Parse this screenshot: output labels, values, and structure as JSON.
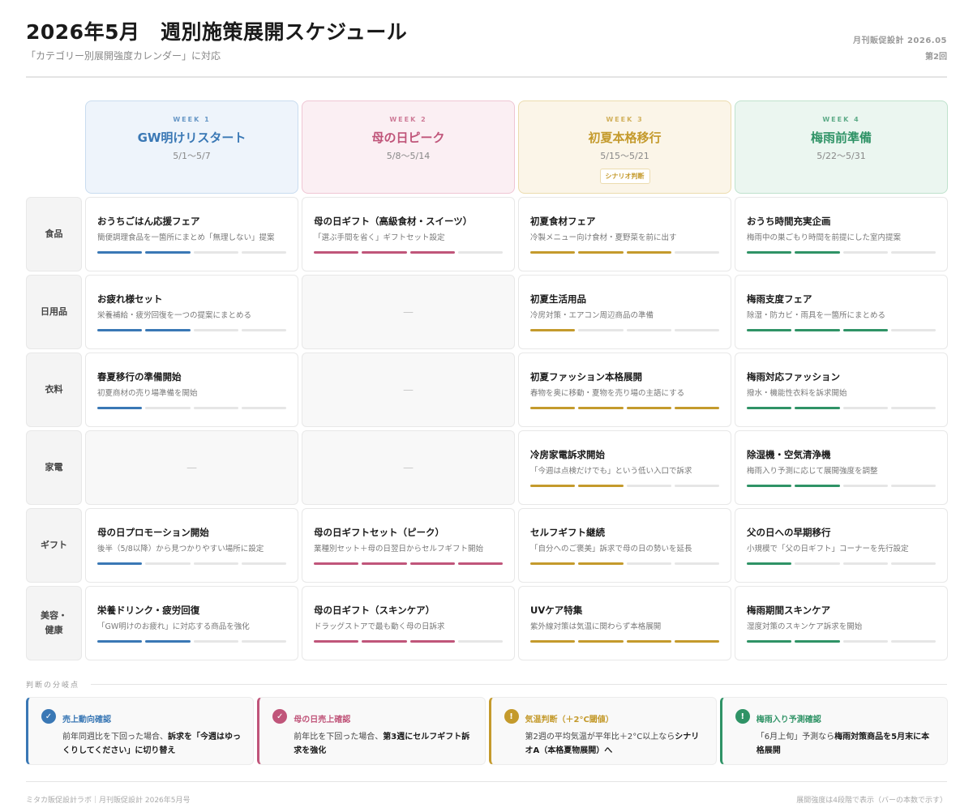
{
  "header": {
    "title": "2026年5月　週別施策展開スケジュール",
    "subtitle": "「カテゴリー別展開強度カレンダー」に対応",
    "publication": "月刊販促設計 2026.05",
    "issue": "第2回"
  },
  "colors": {
    "week1": "#3a78b5",
    "week2": "#c0557a",
    "week3": "#c49a2c",
    "week4": "#2f9366",
    "bar_empty": "#e6e6e6"
  },
  "weeks": [
    {
      "label": "WEEK 1",
      "title": "GW明けリスタート",
      "range": "5/1〜5/7",
      "badge": ""
    },
    {
      "label": "WEEK 2",
      "title": "母の日ピーク",
      "range": "5/8〜5/14",
      "badge": ""
    },
    {
      "label": "WEEK 3",
      "title": "初夏本格移行",
      "range": "5/15〜5/21",
      "badge": "シナリオ判断"
    },
    {
      "label": "WEEK 4",
      "title": "梅雨前準備",
      "range": "5/22〜5/31",
      "badge": ""
    }
  ],
  "categories": [
    {
      "name": "食品",
      "cells": [
        {
          "title": "おうちごはん応援フェア",
          "desc": "簡便調理食品を一箇所にまとめ「無理しない」提案",
          "intensity": 2
        },
        {
          "title": "母の日ギフト（高級食材・スイーツ）",
          "desc": "「選ぶ手間を省く」ギフトセット設定",
          "intensity": 3
        },
        {
          "title": "初夏食材フェア",
          "desc": "冷製メニュー向け食材・夏野菜を前に出す",
          "intensity": 3
        },
        {
          "title": "おうち時間充実企画",
          "desc": "梅雨中の巣ごもり時間を前提にした室内提案",
          "intensity": 2
        }
      ]
    },
    {
      "name": "日用品",
      "cells": [
        {
          "title": "お疲れ様セット",
          "desc": "栄養補給・疲労回復を一つの提案にまとめる",
          "intensity": 2
        },
        null,
        {
          "title": "初夏生活用品",
          "desc": "冷房対策・エアコン周辺商品の準備",
          "intensity": 1
        },
        {
          "title": "梅雨支度フェア",
          "desc": "除湿・防カビ・雨具を一箇所にまとめる",
          "intensity": 3
        }
      ]
    },
    {
      "name": "衣料",
      "cells": [
        {
          "title": "春夏移行の準備開始",
          "desc": "初夏商材の売り場準備を開始",
          "intensity": 1
        },
        null,
        {
          "title": "初夏ファッション本格展開",
          "desc": "春物を奥に移動・夏物を売り場の主語にする",
          "intensity": 4
        },
        {
          "title": "梅雨対応ファッション",
          "desc": "撥水・機能性衣料を訴求開始",
          "intensity": 2
        }
      ]
    },
    {
      "name": "家電",
      "cells": [
        null,
        null,
        {
          "title": "冷房家電訴求開始",
          "desc": "「今週は点検だけでも」という低い入口で訴求",
          "intensity": 2
        },
        {
          "title": "除湿機・空気清浄機",
          "desc": "梅雨入り予測に応じて展開強度を調整",
          "intensity": 2
        }
      ]
    },
    {
      "name": "ギフト",
      "cells": [
        {
          "title": "母の日プロモーション開始",
          "desc": "後半（5/8以降）から見つかりやすい場所に設定",
          "intensity": 1
        },
        {
          "title": "母の日ギフトセット（ピーク）",
          "desc": "業種別セット＋母の日翌日からセルフギフト開始",
          "intensity": 4
        },
        {
          "title": "セルフギフト継続",
          "desc": "「自分へのご褒美」訴求で母の日の勢いを延長",
          "intensity": 2
        },
        {
          "title": "父の日への早期移行",
          "desc": "小規模で「父の日ギフト」コーナーを先行設定",
          "intensity": 1
        }
      ]
    },
    {
      "name": "美容・\n健康",
      "cells": [
        {
          "title": "栄養ドリンク・疲労回復",
          "desc": "「GW明けのお疲れ」に対応する商品を強化",
          "intensity": 2
        },
        {
          "title": "母の日ギフト（スキンケア）",
          "desc": "ドラッグストアで最も動く母の日訴求",
          "intensity": 3
        },
        {
          "title": "UVケア特集",
          "desc": "紫外線対策は気温に関わらず本格展開",
          "intensity": 4
        },
        {
          "title": "梅雨期間スキンケア",
          "desc": "湿度対策のスキンケア訴求を開始",
          "intensity": 2
        }
      ]
    }
  ],
  "empty_placeholder": "—",
  "decision_section": {
    "label": "判断の分岐点",
    "notes": [
      {
        "icon": "check-icon",
        "glyph": "✓",
        "title": "売上動向確認",
        "body_plain": "前年同週比を下回った場合、",
        "body_bold": "訴求を「今週はゆっくりしてください」に切り替え",
        "body_tail": ""
      },
      {
        "icon": "check-icon",
        "glyph": "✓",
        "title": "母の日売上確認",
        "body_plain": "前年比を下回った場合、",
        "body_bold": "第3週にセルフギフト訴求を強化",
        "body_tail": ""
      },
      {
        "icon": "alert-icon",
        "glyph": "!",
        "title": "気温判断（＋2°C閾値）",
        "body_plain": "第2週の平均気温が平年比＋2°C以上なら",
        "body_bold": "シナリオA（本格夏物展開）へ",
        "body_tail": ""
      },
      {
        "icon": "alert-icon",
        "glyph": "!",
        "title": "梅雨入り予測確認",
        "body_plain": "「6月上旬」予測なら",
        "body_bold": "梅雨対策商品を5月末に本格展開",
        "body_tail": ""
      }
    ]
  },
  "footer": {
    "left": "ミタカ販促設計ラボ｜月刊販促設計 2026年5月号",
    "right": "展開強度は4段階で表示（バーの本数で示す）"
  }
}
